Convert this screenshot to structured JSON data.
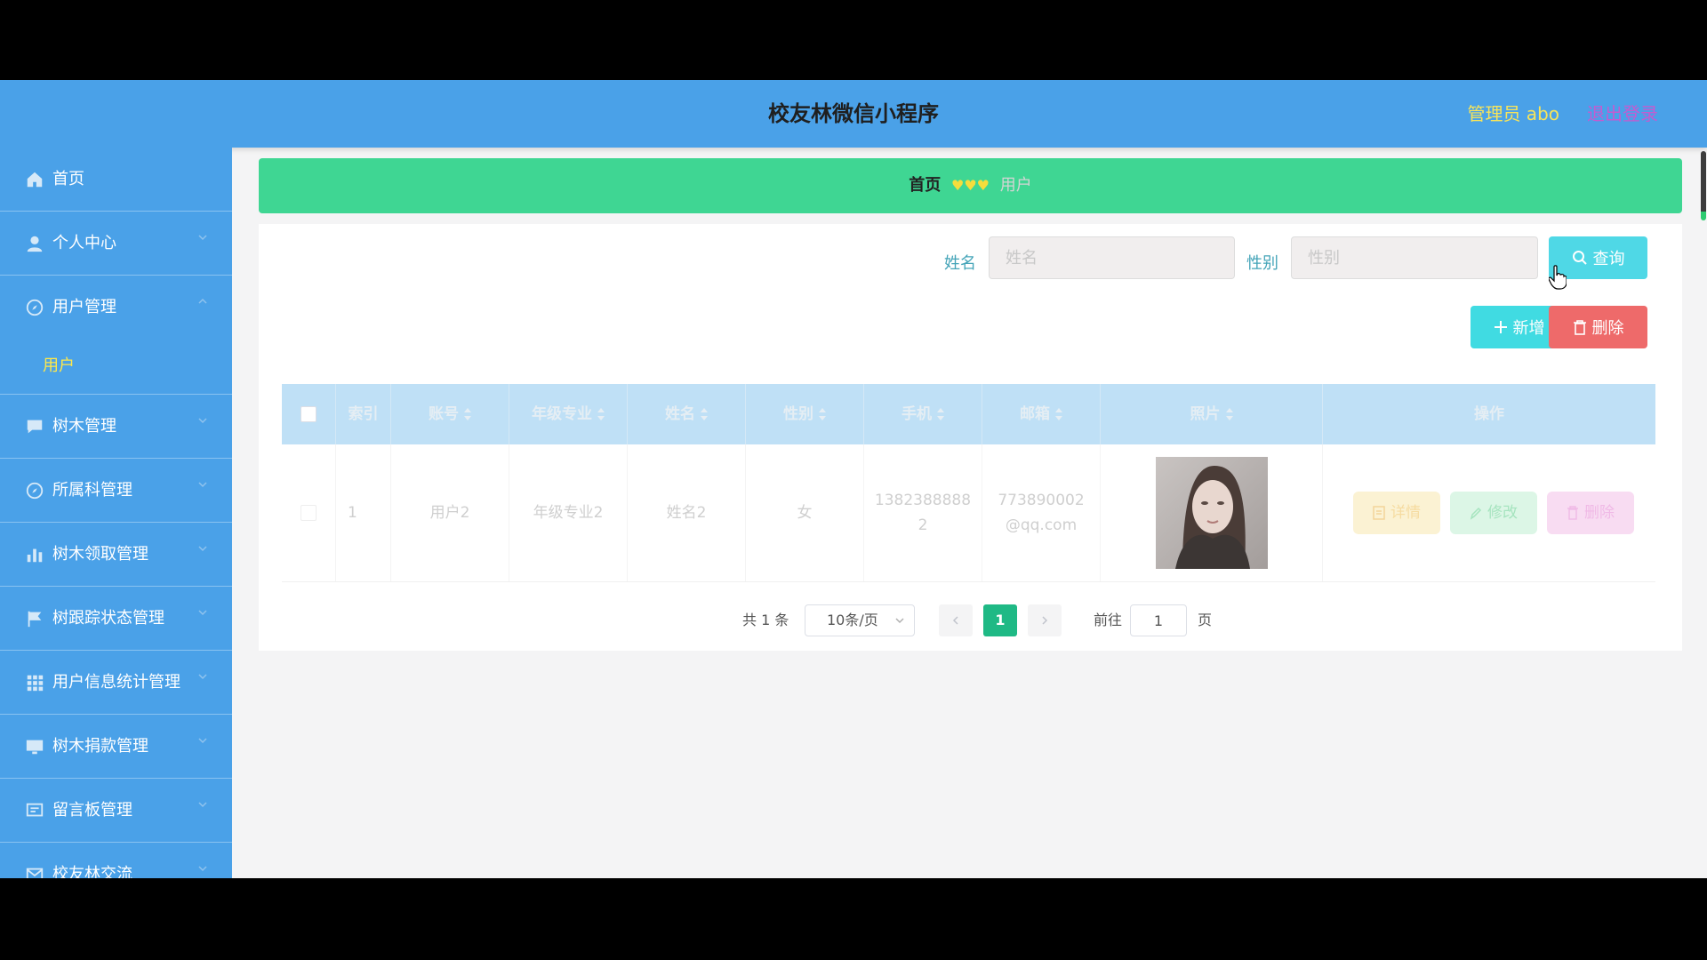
{
  "header": {
    "title": "校友林微信小程序",
    "admin_label": "管理员 abo",
    "logout_label": "退出登录"
  },
  "sidebar": {
    "items": [
      {
        "label": "首页",
        "icon": "home-icon"
      },
      {
        "label": "个人中心",
        "icon": "user-icon"
      },
      {
        "label": "用户管理",
        "icon": "compass-icon",
        "expanded": true,
        "children": [
          {
            "label": "用户"
          }
        ]
      },
      {
        "label": "树木管理",
        "icon": "chat-icon"
      },
      {
        "label": "所属科管理",
        "icon": "compass-icon"
      },
      {
        "label": "树木领取管理",
        "icon": "bar-chart-icon"
      },
      {
        "label": "树跟踪状态管理",
        "icon": "flag-icon"
      },
      {
        "label": "用户信息统计管理",
        "icon": "grid-icon"
      },
      {
        "label": "树木捐款管理",
        "icon": "monitor-icon"
      },
      {
        "label": "留言板管理",
        "icon": "message-icon"
      },
      {
        "label": "校友林交流",
        "icon": "mail-icon"
      }
    ]
  },
  "breadcrumb": {
    "home": "首页",
    "separator": "♥♥♥",
    "current": "用户"
  },
  "search": {
    "name_label": "姓名",
    "name_placeholder": "姓名",
    "name_value": "",
    "gender_label": "性别",
    "gender_placeholder": "性别",
    "gender_value": "",
    "query_button": "查询"
  },
  "actions": {
    "add_button": "新增",
    "delete_button": "删除"
  },
  "table": {
    "columns": [
      "索引",
      "账号",
      "年级专业",
      "姓名",
      "性别",
      "手机",
      "邮箱",
      "照片",
      "操作"
    ],
    "rows": [
      {
        "index": "1",
        "account": "用户2",
        "grade_major": "年级专业2",
        "name": "姓名2",
        "gender": "女",
        "phone_line1": "1382388888",
        "phone_line2": "2",
        "email_line1": "773890002",
        "email_line2": "@qq.com",
        "actions": {
          "detail": "详情",
          "edit": "修改",
          "delete": "删除"
        }
      }
    ]
  },
  "pagination": {
    "total_label": "共 1 条",
    "page_size": "10条/页",
    "current_page": "1",
    "goto_label": "前往",
    "goto_value": "1",
    "page_suffix": "页"
  },
  "colors": {
    "header_bg": "#4aa1e8",
    "breadcrumb_bg": "#3fd693",
    "query_btn": "#4fd8e6",
    "add_btn": "#40dbe2",
    "delete_btn": "#ee6a6a",
    "active_page": "#1fb985"
  }
}
